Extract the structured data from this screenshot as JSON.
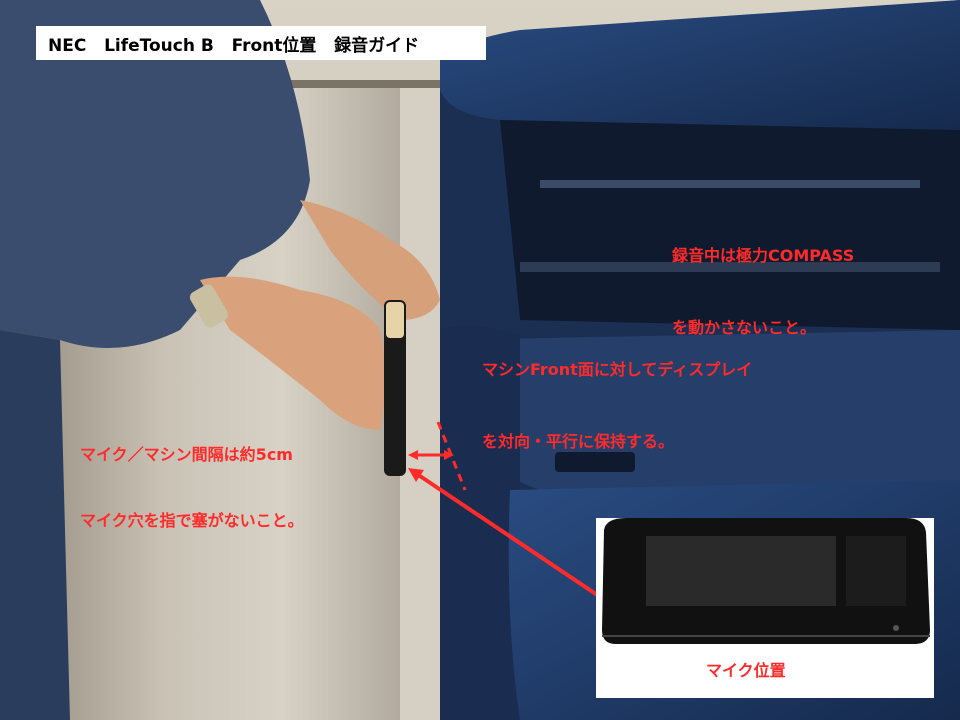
{
  "title": "NEC   LifeTouch B   Front位置   録音ガイド",
  "notes": {
    "keep_still": [
      "録音中は極力COMPASS",
      "を動かさないこと。"
    ],
    "parallel": [
      "マシンFront面に対してディスプレイ",
      "を対向・平行に保持する。"
    ],
    "distance": "マイク／マシン間隔は約5cm",
    "mic_hole": "マイク穴を指で塞がないこと。",
    "inset_label": "マイク位置"
  },
  "colors": {
    "annotation": "#ff2a2a",
    "machine_blue": "#1f3b66",
    "steel": "#b9b2a4"
  }
}
